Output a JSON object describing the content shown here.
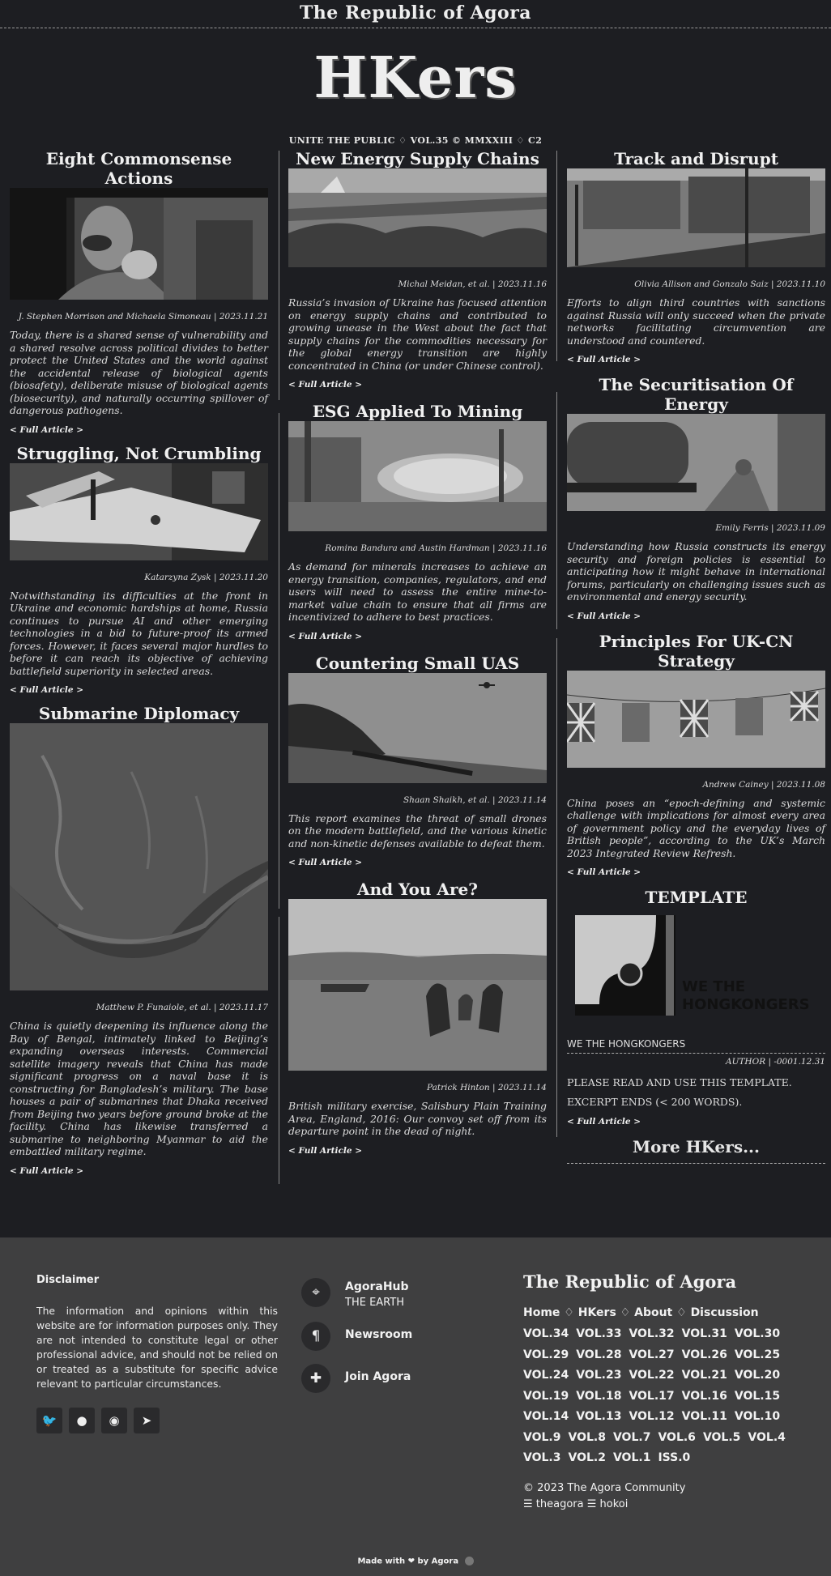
{
  "masthead": {
    "top_title": "The Republic of Agora",
    "logo": "HKers",
    "tagline": "UNITE THE PUBLIC ♢ VOL.35 © MMXXIII ♢ C2"
  },
  "articles": {
    "a1": {
      "title": "Eight Commonsense Actions",
      "byline": "J. Stephen Morrison and Michaela Simoneau | 2023.11.21",
      "summary": "Today, there is a shared sense of vulnerability and a shared resolve across political divides to better protect the United States and the world against the accidental release of biological agents (biosafety), deliberate misuse of biological agents (biosecurity), and naturally occurring spillover of dangerous pathogens.",
      "more": "< Full Article >"
    },
    "a2": {
      "title": "Struggling, Not Crumbling",
      "byline": "Katarzyna Zysk | 2023.11.20",
      "summary": "Notwithstanding its difficulties at the front in Ukraine and economic hardships at home, Russia continues to pursue AI and other emerging technologies in a bid to future-proof its armed forces. However, it faces several major hurdles to before it can reach its objective of achieving battlefield superiority in selected areas.",
      "more": "< Full Article >"
    },
    "a3": {
      "title": "Submarine Diplomacy",
      "byline": "Matthew P. Funaiole, et al. | 2023.11.17",
      "summary": "China is quietly deepening its influence along the Bay of Bengal, intimately linked to Beijing’s expanding overseas interests. Commercial satellite imagery reveals that China has made significant progress on a naval base it is constructing for Bangladesh’s military. The base houses a pair of submarines that Dhaka received from Beijing two years before ground broke at the facility. China has likewise transferred a submarine to neighboring Myanmar to aid the embattled military regime.",
      "more": "< Full Article >"
    },
    "b1": {
      "title": "New Energy Supply Chains",
      "byline": "Michal Meidan, et al. | 2023.11.16",
      "summary": "Russia’s invasion of Ukraine has focused attention on energy supply chains and contributed to growing unease in the West about the fact that supply chains for the commodities necessary for the global energy transition are highly concentrated in China (or under Chinese control).",
      "more": "< Full Article >"
    },
    "b2": {
      "title": "ESG Applied To Mining",
      "byline": "Romina Bandura and Austin Hardman | 2023.11.16",
      "summary": "As demand for minerals increases to achieve an energy transition, companies, regulators, and end users will need to assess the entire mine-to-market value chain to ensure that all firms are incentivized to adhere to best practices.",
      "more": "< Full Article >"
    },
    "b3": {
      "title": "Countering Small UAS",
      "byline": "Shaan Shaikh, et al. | 2023.11.14",
      "summary": "This report examines the threat of small drones on the modern battlefield, and the various kinetic and non-kinetic defenses available to defeat them.",
      "more": "< Full Article >"
    },
    "b4": {
      "title": "And You Are?",
      "byline": "Patrick Hinton | 2023.11.14",
      "summary": "British military exercise, Salisbury Plain Training Area, England, 2016: Our convoy set off from its departure point in the dead of night.",
      "more": "< Full Article >"
    },
    "c1": {
      "title": "Track and Disrupt",
      "byline": "Olivia Allison and Gonzalo Saiz | 2023.11.10",
      "summary": "Efforts to align third countries with sanctions against Russia will only succeed when the private networks facilitating circumvention are understood and countered.",
      "more": "< Full Article >"
    },
    "c2": {
      "title": "The Securitisation Of Energy",
      "byline": "Emily Ferris | 2023.11.09",
      "summary": "Understanding how Russia constructs its energy security and foreign policies is essential to anticipating how it might behave in international forums, particularly on challenging issues such as environmental and energy security.",
      "more": "< Full Article >"
    },
    "c3": {
      "title": "Principles For UK-CN Strategy",
      "byline": "Andrew Cainey | 2023.11.08",
      "summary": "China poses an “epoch-defining and systemic challenge with implications for almost every area of government policy and the everyday lives of British people”, according to the UK’s March 2023 Integrated Review Refresh.",
      "more": "< Full Article >"
    }
  },
  "template": {
    "title": "TEMPLATE",
    "logo_text_1": "WE THE",
    "logo_text_2": "HONGKONGERS",
    "caption": "WE THE HONGKONGERS",
    "author": "AUTHOR | -0001.12.31",
    "line1": "PLEASE READ AND USE THIS TEMPLATE.",
    "line2": "EXCERPT ENDS (< 200 WORDS).",
    "more": "< Full Article >",
    "more_hkers": "More HKers..."
  },
  "footer": {
    "disclaimer_title": "Disclaimer",
    "disclaimer_text": "The information and opinions within this website are for information purposes only. They are not intended to constitute legal or other professional advice, and should not be relied on or treated as a substitute for specific advice relevant to particular circumstances.",
    "contacts": [
      {
        "title": "AgoraHub",
        "sub": "THE EARTH",
        "icon": "map-pin-icon"
      },
      {
        "title": "Newsroom",
        "sub": "",
        "icon": "pilcrow-icon"
      },
      {
        "title": "Join Agora",
        "sub": "",
        "icon": "puzzle-icon"
      }
    ],
    "rep_title": "The Republic of Agora",
    "nav": [
      "Home",
      "HKers",
      "About",
      "Discussion"
    ],
    "volumes": [
      "VOL.34",
      "VOL.33",
      "VOL.32",
      "VOL.31",
      "VOL.30",
      "VOL.29",
      "VOL.28",
      "VOL.27",
      "VOL.26",
      "VOL.25",
      "VOL.24",
      "VOL.23",
      "VOL.22",
      "VOL.21",
      "VOL.20",
      "VOL.19",
      "VOL.18",
      "VOL.17",
      "VOL.16",
      "VOL.15",
      "VOL.14",
      "VOL.13",
      "VOL.12",
      "VOL.11",
      "VOL.10",
      "VOL.9",
      "VOL.8",
      "VOL.7",
      "VOL.6",
      "VOL.5",
      "VOL.4",
      "VOL.3",
      "VOL.2",
      "VOL.1",
      "ISS.0"
    ],
    "copyright": "© 2023 The Agora Community",
    "links_line": "☰ theagora ☰ hokoi",
    "made_with": "Made with ❤ by Agora"
  }
}
